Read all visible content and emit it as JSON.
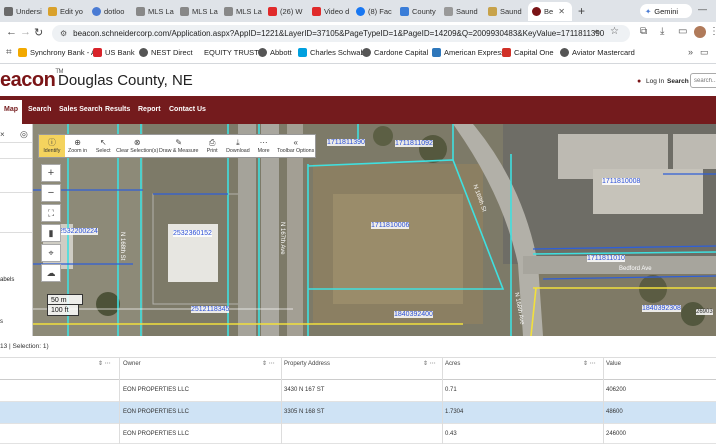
{
  "browser": {
    "tabs": [
      {
        "label": "Undersi",
        "color": "#6a6a6a"
      },
      {
        "label": "Edit yo",
        "color": "#d9a12b"
      },
      {
        "label": "dotloo",
        "color": "#4a7bd4"
      },
      {
        "label": "MLS La",
        "color": "#888888"
      },
      {
        "label": "MLS La",
        "color": "#888888"
      },
      {
        "label": "MLS La",
        "color": "#888888"
      },
      {
        "label": "(26) W",
        "color": "#e02a2a"
      },
      {
        "label": "Video d",
        "color": "#e02a2a"
      },
      {
        "label": "(8) Fac",
        "color": "#1877f2"
      },
      {
        "label": "County",
        "color": "#3a7dd8"
      },
      {
        "label": "Saund",
        "color": "#999999"
      },
      {
        "label": "Saund",
        "color": "#c7a24a"
      },
      {
        "label": "Be",
        "color": "#7a1416"
      }
    ],
    "gemini_label": "Gemini",
    "url": "beacon.schneidercorp.com/Application.aspx?AppID=1221&LayerID=37105&PageTypeID=1&PageID=14209&Q=2009930483&KeyValue=1711811390",
    "bookmarks": [
      {
        "label": "Synchrony Bank - A...",
        "color": "#f2a900"
      },
      {
        "label": "US Bank",
        "color": "#d8232a"
      },
      {
        "label": "NEST Direct",
        "color": "#555555"
      },
      {
        "label": "EQUITY TRUST",
        "color": ""
      },
      {
        "label": "Abbott",
        "color": "#555555"
      },
      {
        "label": "Charles Schwab",
        "color": "#00a0df"
      },
      {
        "label": "Cardone Capital",
        "color": "#555555"
      },
      {
        "label": "American Express",
        "color": "#2e77bb"
      },
      {
        "label": "Capital One",
        "color": "#d03027"
      },
      {
        "label": "Aviator Mastercard",
        "color": "#555555"
      }
    ]
  },
  "site": {
    "logo": "eacon",
    "logo_tm": "TM",
    "county": "Douglas County, NE",
    "login": "Log In",
    "search_link": "Search",
    "search_placeholder": "search...",
    "nav": [
      "Map",
      "Search",
      "Sales Search",
      "Results",
      "Report",
      "Contact Us"
    ]
  },
  "left_panel": {
    "item1": "abels",
    "item2": "s"
  },
  "map": {
    "toolbar": [
      {
        "label": "Identify",
        "icon": "info-icon",
        "glyph": "ⓘ"
      },
      {
        "label": "Zoom in",
        "icon": "zoom-in-icon",
        "glyph": "⊕"
      },
      {
        "label": "Select",
        "icon": "select-icon",
        "glyph": "↖"
      },
      {
        "label": "Clear Selection(s)",
        "icon": "clear-icon",
        "glyph": "⊗"
      },
      {
        "label": "Draw & Measure",
        "icon": "draw-icon",
        "glyph": "✎"
      },
      {
        "label": "Print",
        "icon": "print-icon",
        "glyph": "⎙"
      },
      {
        "label": "Download",
        "icon": "download-icon",
        "glyph": "⤓"
      },
      {
        "label": "More",
        "icon": "more-icon",
        "glyph": "⋯"
      },
      {
        "label": "Toolbar Options",
        "icon": "collapse-icon",
        "glyph": "«"
      }
    ],
    "parcel_labels": [
      "1711811390",
      "1711811092",
      "1711810006",
      "1711810008",
      "1711811010",
      "1840392308",
      "2532200224",
      "2532360152",
      "2512118345",
      "1840392400",
      "26903"
    ],
    "street_labels": [
      "N 168th St",
      "N 167th Ave",
      "N 169th St",
      "N 168th Ave",
      "Bedford Ave"
    ],
    "scale": [
      "50 m",
      "100 ft"
    ]
  },
  "results": {
    "selection_text": "13 | Selection: 1)",
    "columns": [
      "Owner",
      "Property Address",
      "Acres",
      "Value"
    ],
    "rows": [
      {
        "owner": "EON PROPERTIES LLC",
        "address": "3430 N 167 ST",
        "acres": "0.71",
        "value": "406200",
        "selected": false
      },
      {
        "owner": "EON PROPERTIES LLC",
        "address": "3305 N 168 ST",
        "acres": "1.7304",
        "value": "48600",
        "selected": true
      },
      {
        "owner": "EON PROPERTIES LLC",
        "address": "",
        "acres": "0.43",
        "value": "246000",
        "selected": false
      }
    ]
  }
}
